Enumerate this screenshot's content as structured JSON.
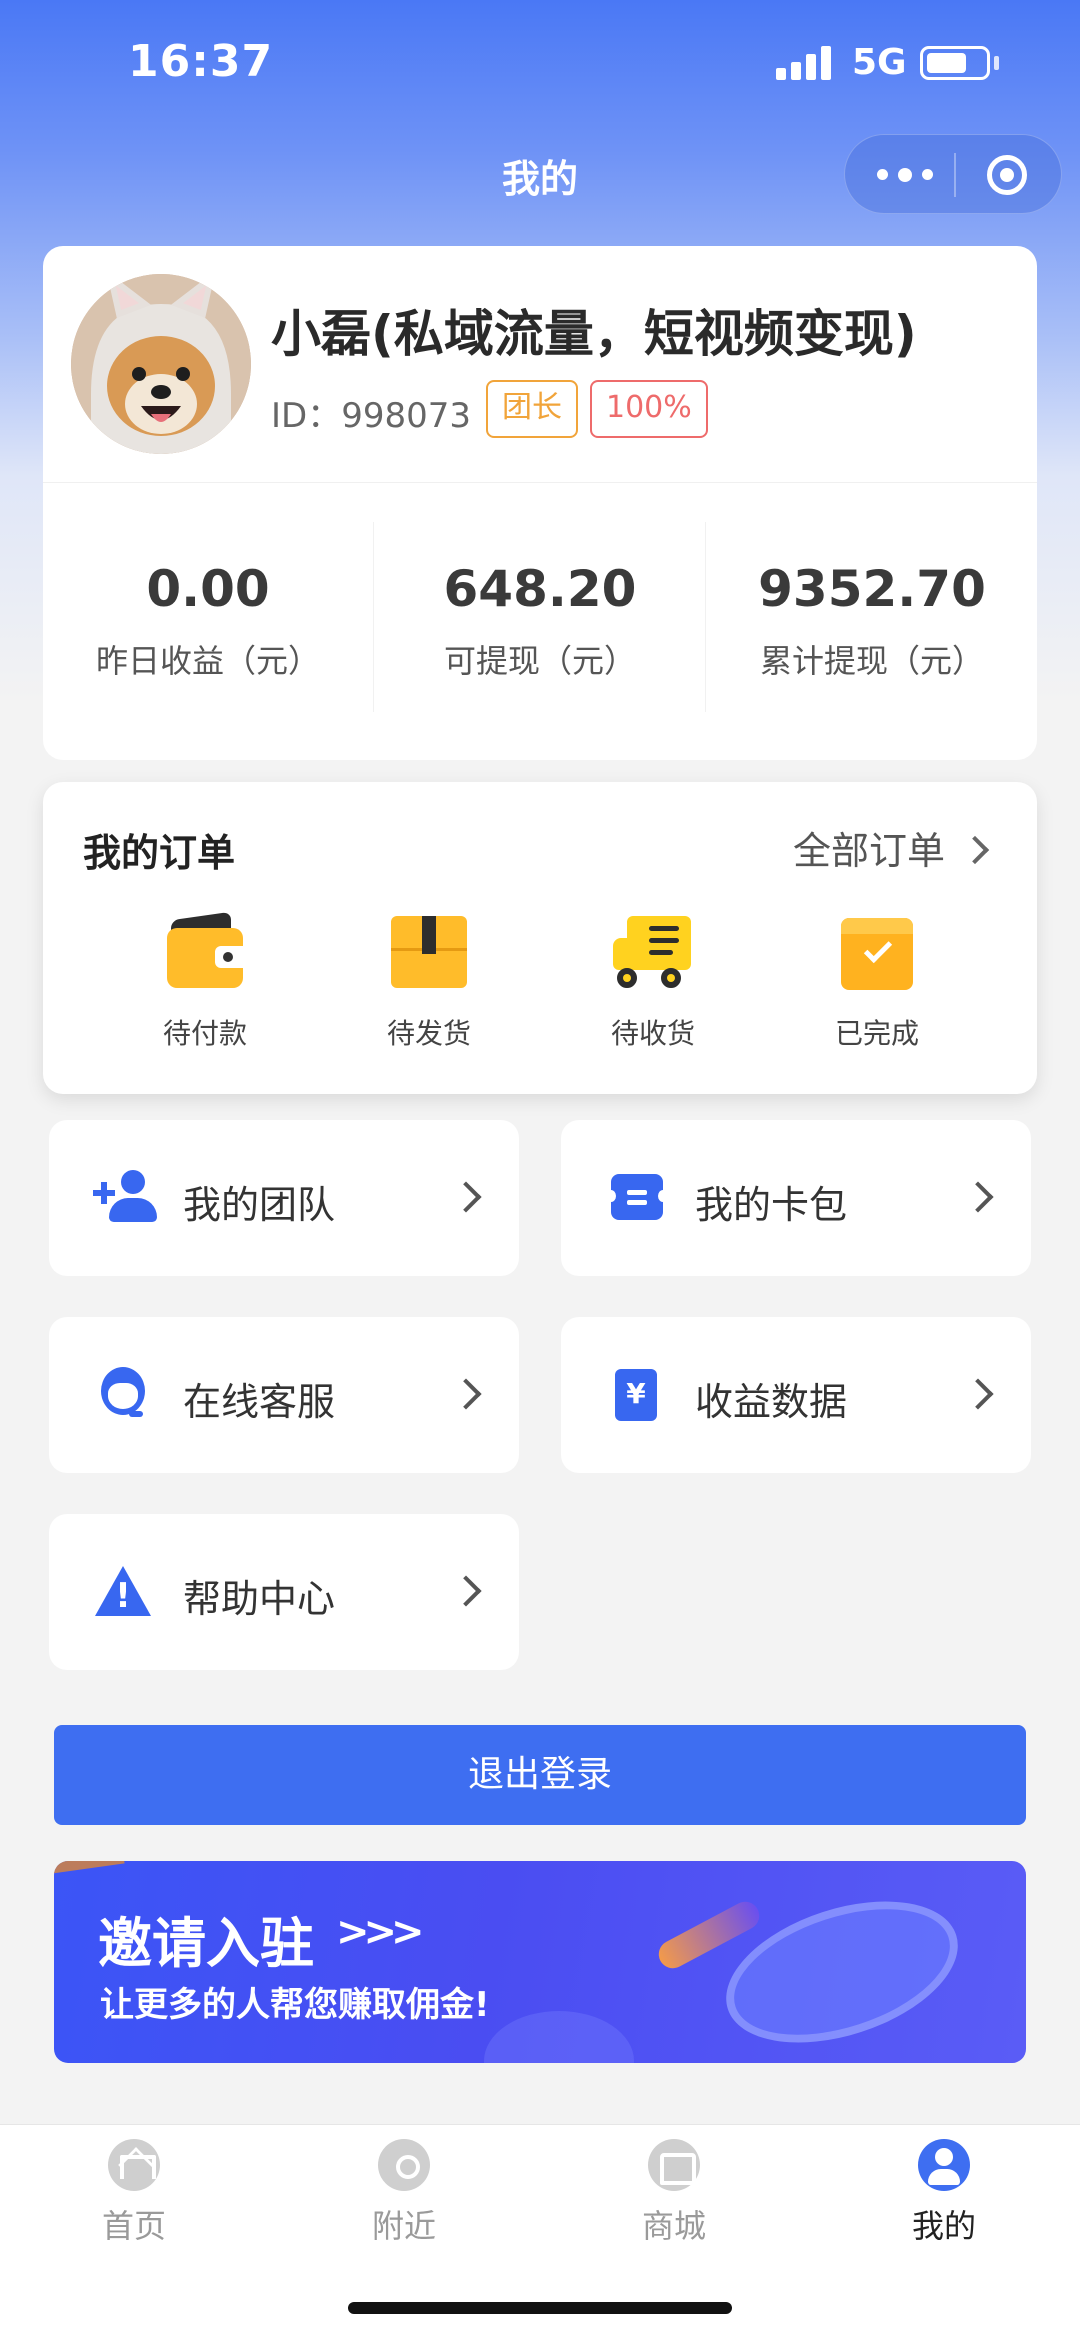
{
  "status_bar": {
    "time": "16:37",
    "network": "5G",
    "battery_percent": 70
  },
  "nav": {
    "title": "我的",
    "more_icon": "more-dots-icon",
    "close_icon": "target-circle-icon"
  },
  "profile": {
    "nickname": "小磊(私域流量，短视频变现)",
    "id_text": "ID：998073",
    "badges": [
      "团长",
      "100%"
    ],
    "stats": [
      {
        "value": "0.00",
        "label": "昨日收益（元）"
      },
      {
        "value": "648.20",
        "label": "可提现（元）"
      },
      {
        "value": "9352.70",
        "label": "累计提现（元）"
      }
    ]
  },
  "orders": {
    "title": "我的订单",
    "all_label": "全部订单",
    "items": [
      {
        "label": "待付款",
        "icon": "wallet-icon"
      },
      {
        "label": "待发货",
        "icon": "package-icon"
      },
      {
        "label": "待收货",
        "icon": "truck-icon"
      },
      {
        "label": "已完成",
        "icon": "check-box-icon"
      }
    ]
  },
  "menu": [
    {
      "label": "我的团队",
      "icon": "add-user-icon"
    },
    {
      "label": "我的卡包",
      "icon": "card-icon"
    },
    {
      "label": "在线客服",
      "icon": "customer-service-icon"
    },
    {
      "label": "收益数据",
      "icon": "earnings-icon"
    },
    {
      "label": "帮助中心",
      "icon": "warning-icon"
    }
  ],
  "logout_label": "退出登录",
  "banner": {
    "title": "邀请入驻",
    "arrows": ">>>",
    "subtitle": "让更多的人帮您赚取佣金!"
  },
  "tabbar": [
    {
      "label": "首页",
      "icon": "home-icon",
      "active": false
    },
    {
      "label": "附近",
      "icon": "location-pin-icon",
      "active": false
    },
    {
      "label": "商城",
      "icon": "shop-icon",
      "active": false
    },
    {
      "label": "我的",
      "icon": "profile-icon",
      "active": true
    }
  ],
  "colors": {
    "brand_blue": "#3e6ef1",
    "order_yellow": "#ffbc2a",
    "role_badge": "#f1a43a",
    "ratio_badge": "#ee6b6b"
  }
}
